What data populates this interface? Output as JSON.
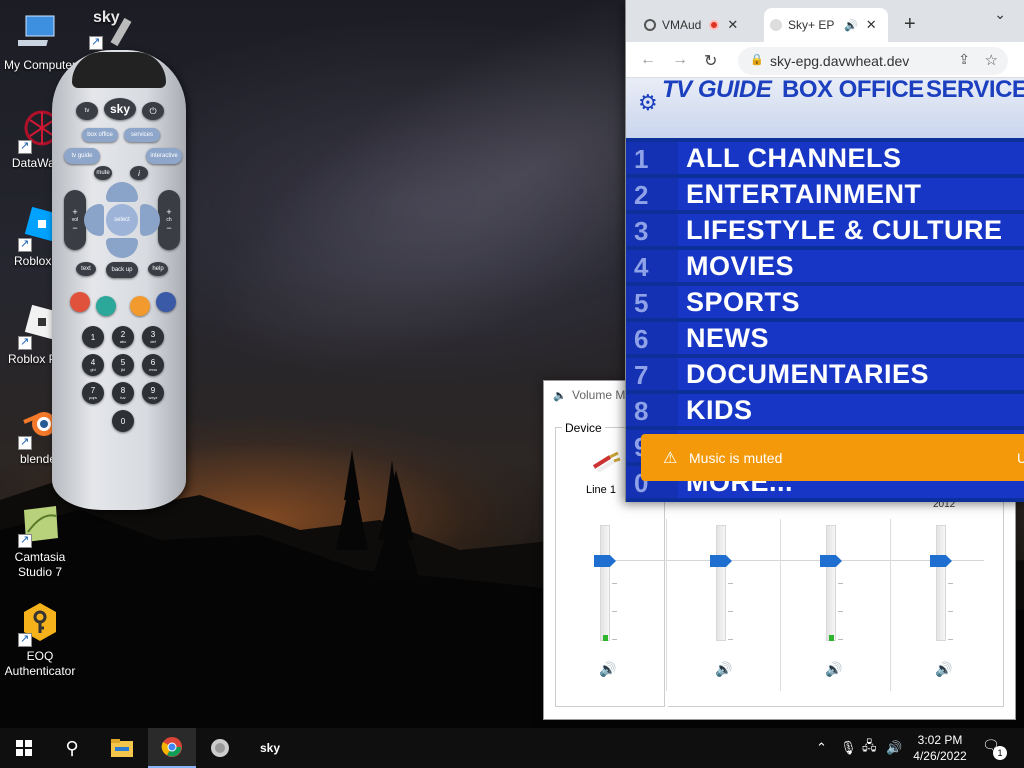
{
  "desktop": {
    "icons": [
      {
        "label": "My Computer"
      },
      {
        "label": "Sky"
      },
      {
        "label": "DataWage"
      },
      {
        "label": "Roblox St"
      },
      {
        "label": "Roblox Play"
      },
      {
        "label": "blender"
      },
      {
        "label": "Camtasia Studio 7"
      },
      {
        "label": "EOQ Authenticator"
      }
    ]
  },
  "remote": {
    "brand": "sky",
    "buttons": {
      "tv": "tv",
      "sky": "sky",
      "box_office": "box office",
      "services": "services",
      "tv_guide": "tv guide",
      "interactive": "interactive",
      "mute": "mute",
      "info": "i",
      "select": "select",
      "text": "text",
      "back_up": "back up",
      "help": "help",
      "vol": "vol",
      "ch": "ch"
    },
    "colors": [
      "#e0523b",
      "#2ba89a",
      "#f39a2e",
      "#3a5aa8"
    ],
    "numbers": [
      {
        "digit": "1",
        "sub": ""
      },
      {
        "digit": "2",
        "sub": "abc"
      },
      {
        "digit": "3",
        "sub": "def"
      },
      {
        "digit": "4",
        "sub": "ghi"
      },
      {
        "digit": "5",
        "sub": "jkl"
      },
      {
        "digit": "6",
        "sub": "mno"
      },
      {
        "digit": "7",
        "sub": "pqrs"
      },
      {
        "digit": "8",
        "sub": "tuv"
      },
      {
        "digit": "9",
        "sub": "wxyz"
      },
      {
        "digit": "0",
        "sub": ""
      }
    ]
  },
  "mixer": {
    "title": "Volume M",
    "device_group": "Device",
    "device_name": "Line 1",
    "app_label": "2012",
    "channels": 4
  },
  "browser": {
    "tabs": [
      {
        "title": "VMAud",
        "active": false
      },
      {
        "title": "Sky+ EP",
        "active": true
      }
    ],
    "new_tab": "+",
    "url": "sky-epg.davwheat.dev",
    "page": {
      "header_tv_guide": "TV GUIDE",
      "header_box_office": "BOX OFFICE",
      "header_services": "SERVICES",
      "menu": [
        {
          "num": "1",
          "label": "ALL CHANNELS"
        },
        {
          "num": "2",
          "label": "ENTERTAINMENT"
        },
        {
          "num": "3",
          "label": "LIFESTYLE & CULTURE"
        },
        {
          "num": "4",
          "label": "MOVIES"
        },
        {
          "num": "5",
          "label": "SPORTS"
        },
        {
          "num": "6",
          "label": "NEWS"
        },
        {
          "num": "7",
          "label": "DOCUMENTARIES"
        },
        {
          "num": "8",
          "label": "KIDS"
        },
        {
          "num": "9",
          "label": ""
        },
        {
          "num": "0",
          "label": "MORE..."
        }
      ]
    },
    "toast": {
      "message": "Music is muted",
      "action": "U"
    }
  },
  "taskbar": {
    "time": "3:02 PM",
    "date": "4/26/2022",
    "notification_count": "1"
  },
  "colors": {
    "epg_blue": "#1836c6",
    "toast_orange": "#f49a0a",
    "slider_blue": "#1e6fd0"
  }
}
